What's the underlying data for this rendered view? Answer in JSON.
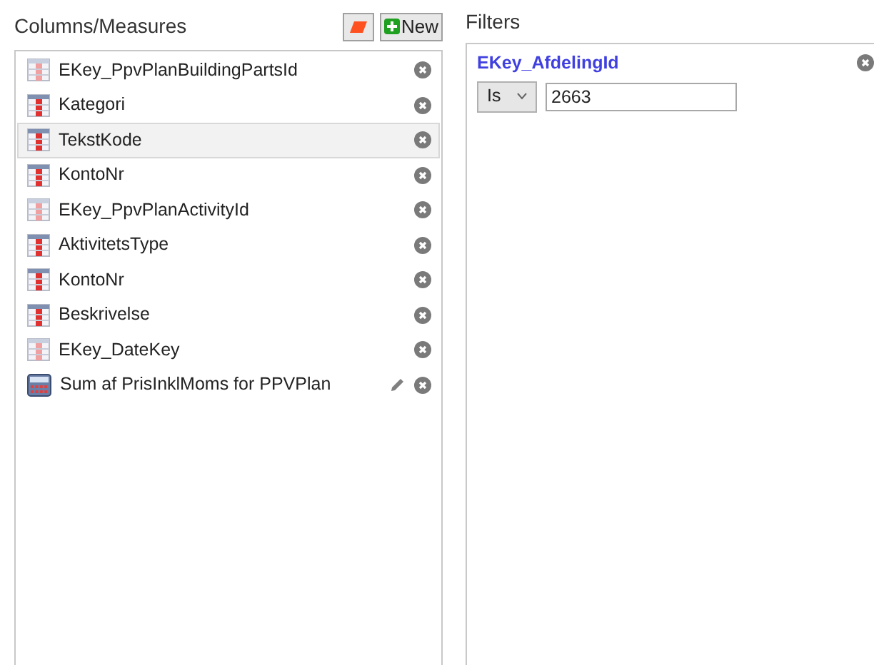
{
  "columns_panel": {
    "title": "Columns/Measures",
    "new_button": "New",
    "items": [
      {
        "kind": "key",
        "label": "EKey_PpvPlanBuildingPartsId",
        "selected": false
      },
      {
        "kind": "column",
        "label": "Kategori",
        "selected": false
      },
      {
        "kind": "column",
        "label": "TekstKode",
        "selected": true
      },
      {
        "kind": "column",
        "label": "KontoNr",
        "selected": false
      },
      {
        "kind": "key",
        "label": "EKey_PpvPlanActivityId",
        "selected": false
      },
      {
        "kind": "column",
        "label": "AktivitetsType",
        "selected": false
      },
      {
        "kind": "column",
        "label": "KontoNr",
        "selected": false
      },
      {
        "kind": "column",
        "label": "Beskrivelse",
        "selected": false
      },
      {
        "kind": "key",
        "label": "EKey_DateKey",
        "selected": false
      },
      {
        "kind": "measure",
        "label": "Sum af PrisInklMoms for PPVPlan",
        "selected": false
      }
    ]
  },
  "filters_panel": {
    "title": "Filters",
    "filters": [
      {
        "field": "EKey_AfdelingId",
        "operator": "Is",
        "value": "2663"
      }
    ]
  }
}
